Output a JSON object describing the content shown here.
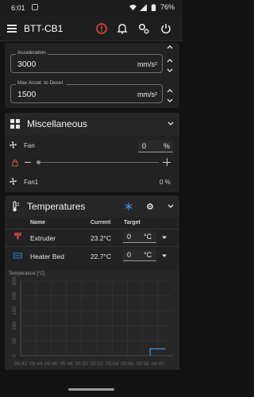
{
  "status_bar": {
    "time": "6:01",
    "battery": "76%"
  },
  "app_bar": {
    "title": "BTT-CB1"
  },
  "accel_fields": [
    {
      "label": "Acceleration",
      "value": "3000",
      "unit": "mm/s²"
    },
    {
      "label": "Max Accel. to Decel.",
      "value": "1500",
      "unit": "mm/s²"
    }
  ],
  "misc": {
    "title": "Miscellaneous",
    "fan_label": "Fan",
    "fan_value": "0",
    "fan_unit": "%",
    "fan_level": 0,
    "fan1_label": "Fan1",
    "fan1_value": "0 %"
  },
  "temps": {
    "title": "Temperatures",
    "headers": [
      "Name",
      "Current",
      "Target"
    ],
    "rows": [
      {
        "name": "Extruder",
        "current": "23.2°C",
        "target": "0",
        "unit": "°C"
      },
      {
        "name": "Heater Bed",
        "current": "22.7°C",
        "target": "0",
        "unit": "°C"
      }
    ]
  },
  "chart_data": {
    "type": "line",
    "ylabel": "Temperature [°C]",
    "ylim": [
      0,
      250
    ],
    "yticks": [
      "0",
      "50",
      "100",
      "150",
      "200",
      "250"
    ],
    "xticks": [
      "05:42",
      "05:44",
      "05:46",
      "05:48",
      "05:50",
      "05:52",
      "05:54",
      "05:56",
      "05:58",
      "06:00"
    ],
    "series": [
      {
        "color": "#4d8fd4",
        "x": [
          "05:59",
          "05:59",
          "06:01"
        ],
        "values": [
          0,
          23,
          23
        ]
      }
    ],
    "grid": true
  },
  "colors": {
    "accent": "#4d8fd4",
    "alert": "#e0473f",
    "extruder": "#b0413e",
    "bed": "#3a7cc4"
  }
}
